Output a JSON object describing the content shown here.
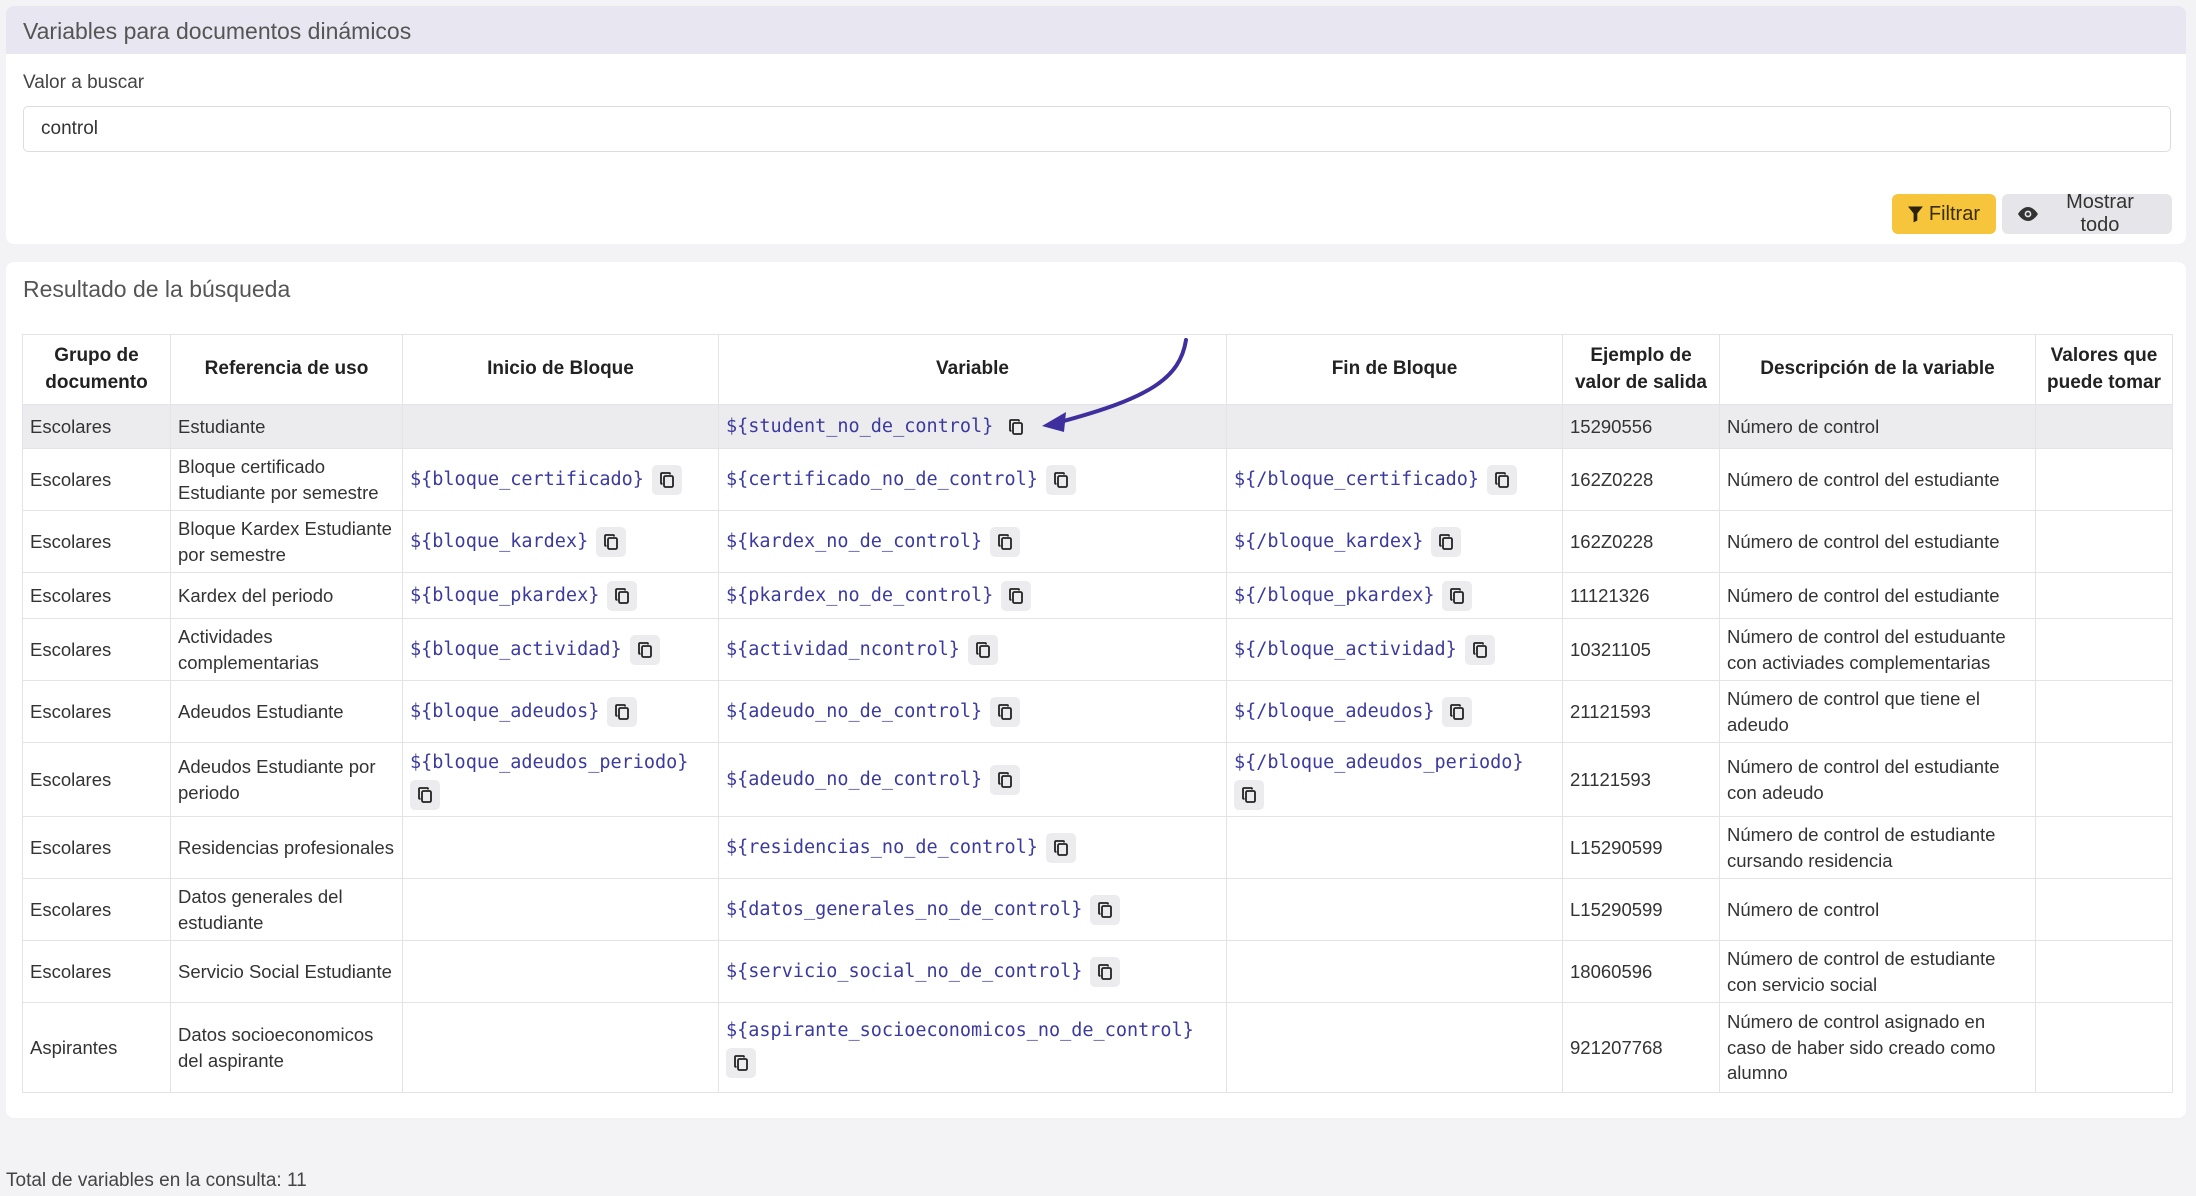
{
  "search_card": {
    "title": "Variables para documentos dinámicos",
    "field_label": "Valor a buscar",
    "input_value": "control",
    "filter_label": "Filtrar",
    "show_all_label": "Mostrar todo"
  },
  "results": {
    "title": "Resultado de la búsqueda",
    "columns": [
      "Grupo de documento",
      "Referencia de uso",
      "Inicio de Bloque",
      "Variable",
      "Fin de Bloque",
      "Ejemplo de valor de salida",
      "Descripción de la variable",
      "Valores que puede tomar"
    ],
    "rows": [
      {
        "grupo": "Escolares",
        "referencia": "Estudiante",
        "inicio": "",
        "variable": "${student_no_de_control}",
        "fin": "",
        "ejemplo": "15290556",
        "descripcion": "Número de control",
        "valores": ""
      },
      {
        "grupo": "Escolares",
        "referencia": "Bloque certificado Estudiante por semestre",
        "inicio": "${bloque_certificado}",
        "variable": "${certificado_no_de_control}",
        "fin": "${/bloque_certificado}",
        "ejemplo": "162Z0228",
        "descripcion": "Número de control del estudiante",
        "valores": ""
      },
      {
        "grupo": "Escolares",
        "referencia": "Bloque Kardex Estudiante por semestre",
        "inicio": "${bloque_kardex}",
        "variable": "${kardex_no_de_control}",
        "fin": "${/bloque_kardex}",
        "ejemplo": "162Z0228",
        "descripcion": "Número de control del estudiante",
        "valores": ""
      },
      {
        "grupo": "Escolares",
        "referencia": "Kardex del periodo",
        "inicio": "${bloque_pkardex}",
        "variable": "${pkardex_no_de_control}",
        "fin": "${/bloque_pkardex}",
        "ejemplo": "11121326",
        "descripcion": "Número de control del estudiante",
        "valores": ""
      },
      {
        "grupo": "Escolares",
        "referencia": "Actividades complementarias",
        "inicio": "${bloque_actividad}",
        "variable": "${actividad_ncontrol}",
        "fin": "${/bloque_actividad}",
        "ejemplo": "10321105",
        "descripcion": "Número de control del estuduante con activiades complementarias",
        "valores": ""
      },
      {
        "grupo": "Escolares",
        "referencia": "Adeudos Estudiante",
        "inicio": "${bloque_adeudos}",
        "variable": "${adeudo_no_de_control}",
        "fin": "${/bloque_adeudos}",
        "ejemplo": "21121593",
        "descripcion": "Número de control que tiene el adeudo",
        "valores": ""
      },
      {
        "grupo": "Escolares",
        "referencia": "Adeudos Estudiante por periodo",
        "inicio": "${bloque_adeudos_periodo}",
        "variable": "${adeudo_no_de_control}",
        "fin": "${/bloque_adeudos_periodo}",
        "ejemplo": "21121593",
        "descripcion": "Número de control del estudiante con adeudo",
        "valores": ""
      },
      {
        "grupo": "Escolares",
        "referencia": "Residencias profesionales",
        "inicio": "",
        "variable": "${residencias_no_de_control}",
        "fin": "",
        "ejemplo": "L15290599",
        "descripcion": "Número de control de estudiante cursando residencia",
        "valores": ""
      },
      {
        "grupo": "Escolares",
        "referencia": "Datos generales del estudiante",
        "inicio": "",
        "variable": "${datos_generales_no_de_control}",
        "fin": "",
        "ejemplo": "L15290599",
        "descripcion": "Número de control",
        "valores": ""
      },
      {
        "grupo": "Escolares",
        "referencia": "Servicio Social Estudiante",
        "inicio": "",
        "variable": "${servicio_social_no_de_control}",
        "fin": "",
        "ejemplo": "18060596",
        "descripcion": "Número de control de estudiante con servicio social",
        "valores": ""
      },
      {
        "grupo": "Aspirantes",
        "referencia": "Datos socioeconomicos del aspirante",
        "inicio": "",
        "variable": "${aspirante_socioeconomicos_no_de_control}",
        "fin": "",
        "ejemplo": "921207768",
        "descripcion": "Número de control asignado en caso de haber sido creado como alumno",
        "valores": ""
      }
    ],
    "total_text": "Total de variables en la consulta: 11"
  },
  "icons": [
    "filter-icon",
    "eye-icon",
    "copy-icon"
  ],
  "colors": {
    "accent_button": "#f7c53b",
    "code_text": "#3b3a9f",
    "header_band": "#e8e6f0",
    "annotation_arrow": "#3f2f9e"
  }
}
